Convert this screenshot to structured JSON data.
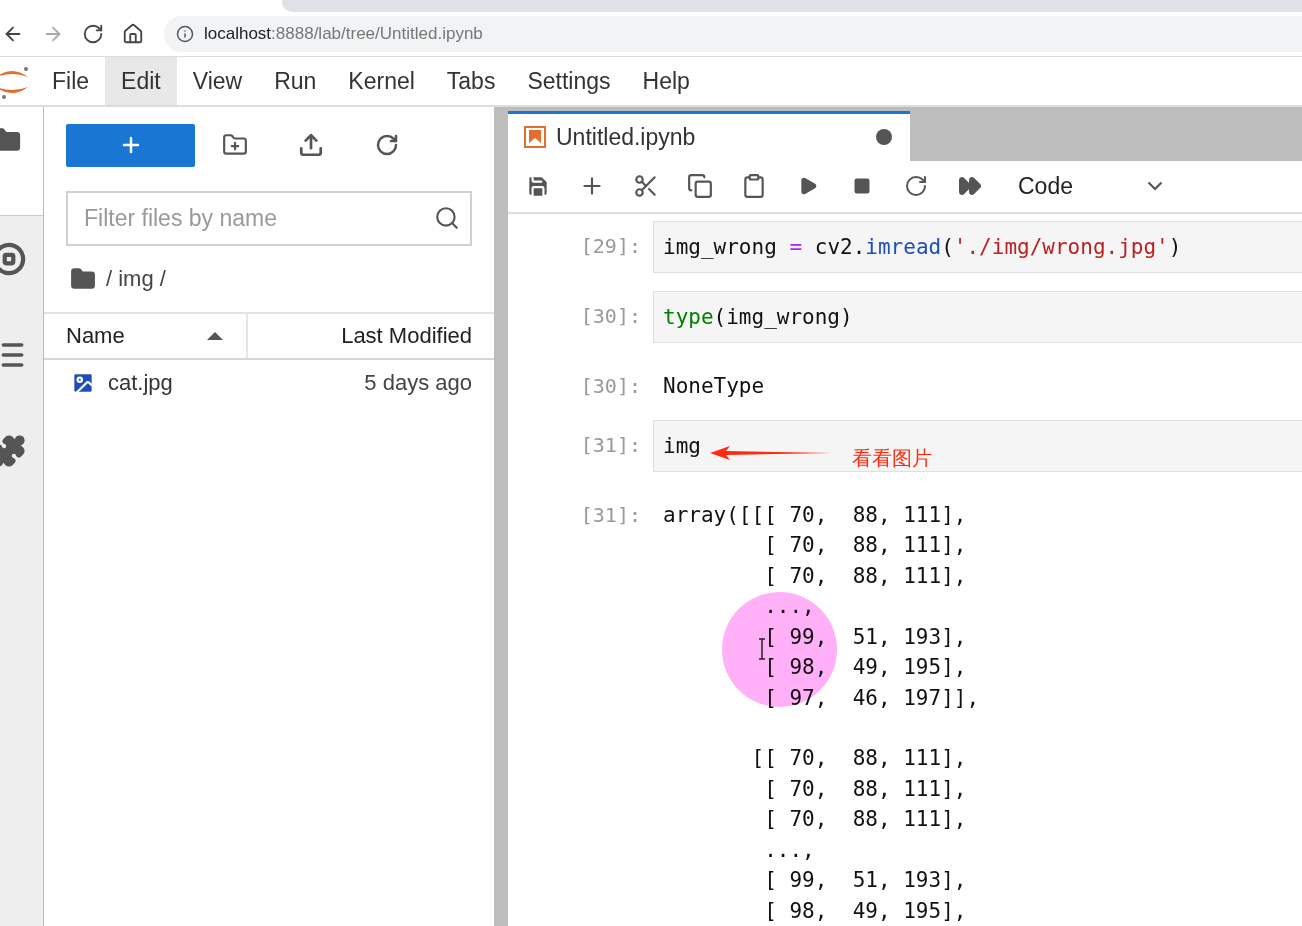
{
  "browser": {
    "back_disabled": false,
    "forward_disabled": true,
    "url_host": "localhost",
    "url_path": ":8888/lab/tree/Untitled.ipynb"
  },
  "menu": [
    {
      "label": "File",
      "selected": false
    },
    {
      "label": "Edit",
      "selected": true
    },
    {
      "label": "View",
      "selected": false
    },
    {
      "label": "Run",
      "selected": false
    },
    {
      "label": "Kernel",
      "selected": false
    },
    {
      "label": "Tabs",
      "selected": false
    },
    {
      "label": "Settings",
      "selected": false
    },
    {
      "label": "Help",
      "selected": false
    }
  ],
  "file_browser": {
    "filter_placeholder": "Filter files by name",
    "breadcrumb": "/ img /",
    "sort_ascending": true,
    "columns": [
      {
        "label": "Name",
        "sorted": true
      },
      {
        "label": "Last Modified",
        "sorted": false
      }
    ],
    "files": [
      {
        "name": "cat.jpg",
        "modified": "5 days ago",
        "selected": false
      }
    ]
  },
  "notebook": {
    "tab_title": "Untitled.ipynb",
    "unsaved": true,
    "cell_type": "Code",
    "cells": [
      {
        "kind": "input",
        "prompt": "[29]:",
        "tokens": [
          {
            "text": "img_wrong ",
            "kind": "plain"
          },
          {
            "text": "=",
            "kind": "operator"
          },
          {
            "text": " cv2.",
            "kind": "plain"
          },
          {
            "text": "imread",
            "kind": "attr"
          },
          {
            "text": "(",
            "kind": "plain"
          },
          {
            "text": "'./img/wrong.jpg'",
            "kind": "string"
          },
          {
            "text": ")",
            "kind": "plain"
          }
        ]
      },
      {
        "kind": "input",
        "prompt": "[30]:",
        "tokens": [
          {
            "text": "type",
            "kind": "builtin"
          },
          {
            "text": "(img_wrong)",
            "kind": "plain"
          }
        ]
      },
      {
        "kind": "output",
        "prompt": "[30]:",
        "blocks": [
          [
            "NoneType"
          ]
        ]
      },
      {
        "kind": "input",
        "prompt": "[31]:",
        "tokens": [
          {
            "text": "img",
            "kind": "plain"
          }
        ],
        "note": "看看图片"
      },
      {
        "kind": "output",
        "prompt": "[31]:",
        "blocks": [
          [
            "array([[[ 70,  88, 111],",
            "        [ 70,  88, 111],",
            "        [ 70,  88, 111],",
            "        ...,",
            "        [ 99,  51, 193],",
            "        [ 98,  49, 195],",
            "        [ 97,  46, 197]],"
          ],
          [
            "       [[ 70,  88, 111],",
            "        [ 70,  88, 111],",
            "        [ 70,  88, 111],",
            "        ...,",
            "        [ 99,  51, 193],",
            "        [ 98,  49, 195],"
          ]
        ]
      }
    ]
  }
}
